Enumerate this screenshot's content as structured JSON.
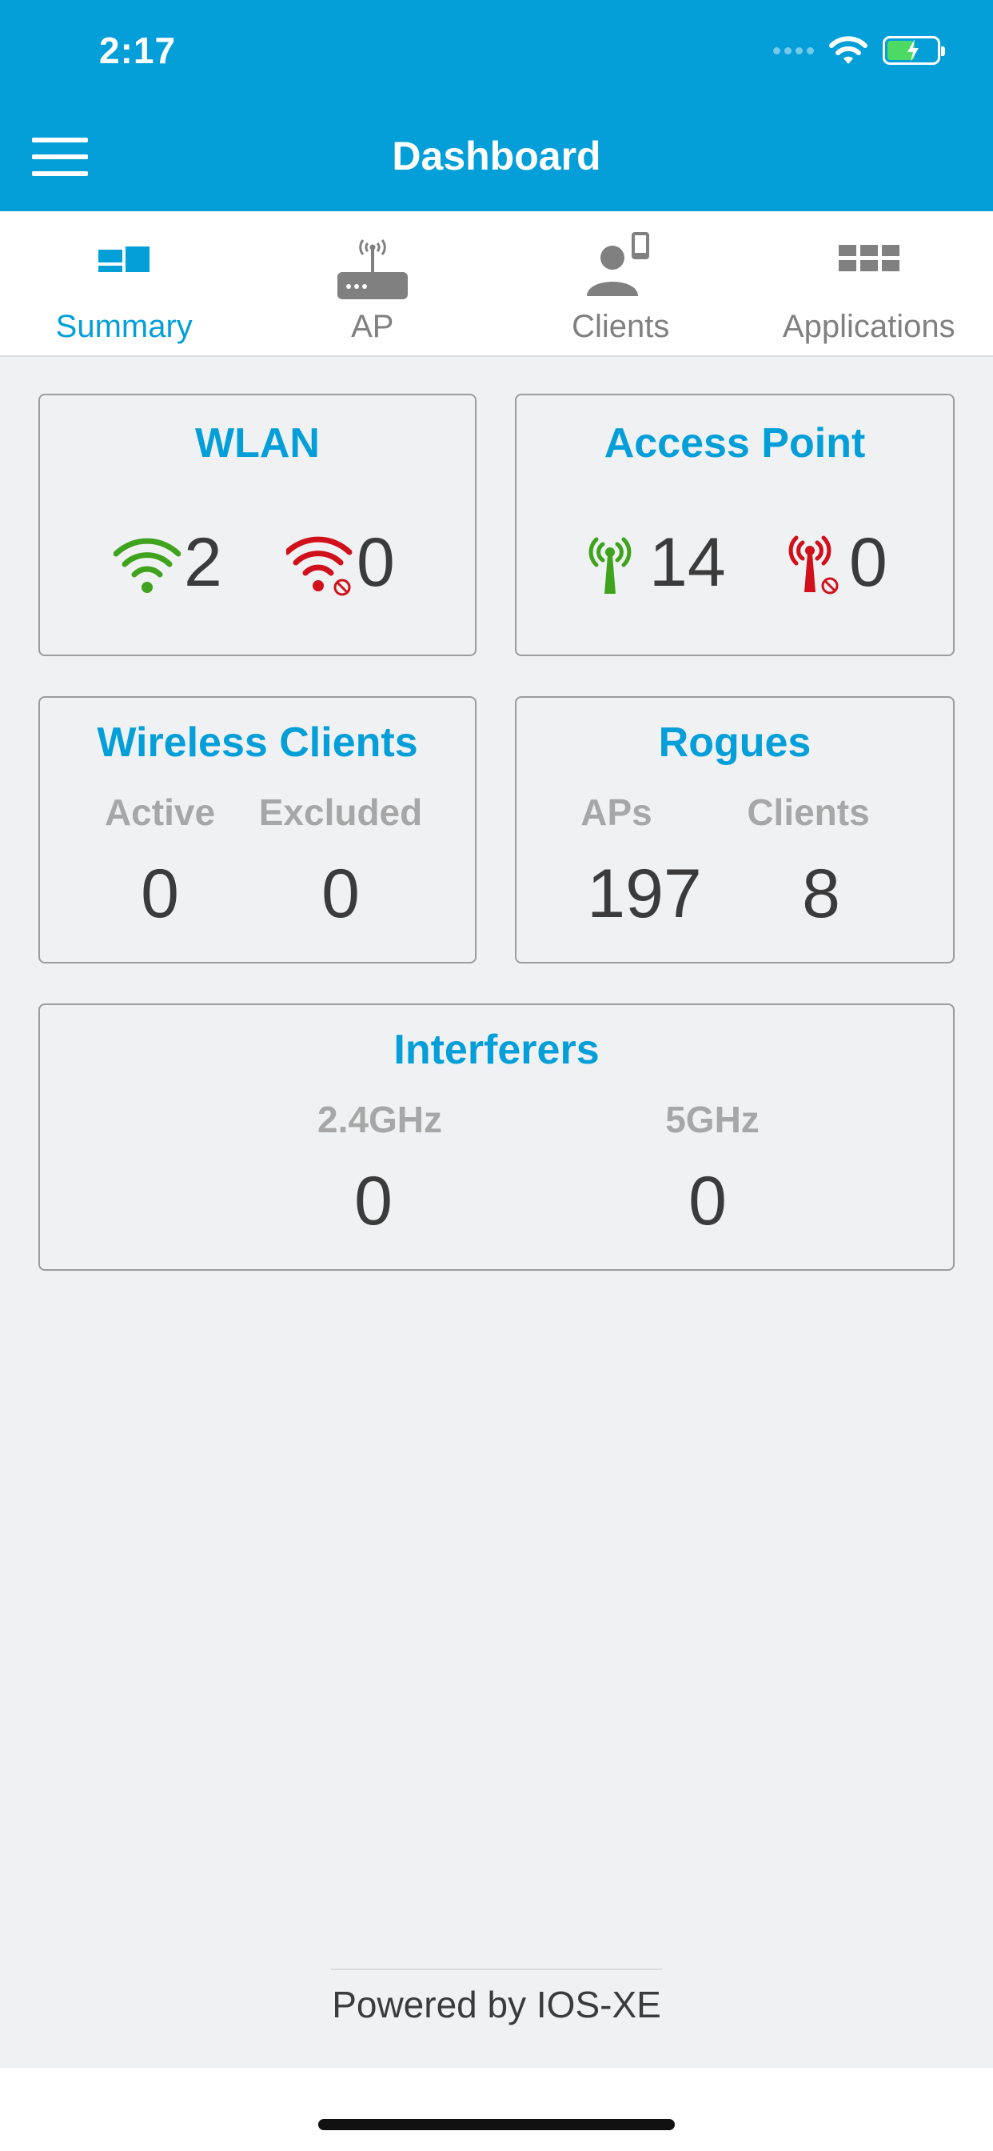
{
  "status_bar": {
    "time": "2:17"
  },
  "header": {
    "title": "Dashboard"
  },
  "tabs": [
    {
      "label": "Summary",
      "icon": "summary-icon",
      "active": true
    },
    {
      "label": "AP",
      "icon": "access-point-icon",
      "active": false
    },
    {
      "label": "Clients",
      "icon": "client-icon",
      "active": false
    },
    {
      "label": "Applications",
      "icon": "grid-icon",
      "active": false
    }
  ],
  "cards": {
    "wlan": {
      "title": "WLAN",
      "up": "2",
      "down": "0"
    },
    "access_point": {
      "title": "Access Point",
      "up": "14",
      "down": "0"
    },
    "wireless_clients": {
      "title": "Wireless Clients",
      "columns": [
        {
          "label": "Active",
          "value": "0"
        },
        {
          "label": "Excluded",
          "value": "0"
        }
      ]
    },
    "rogues": {
      "title": "Rogues",
      "columns": [
        {
          "label": "APs",
          "value": "197"
        },
        {
          "label": "Clients",
          "value": "8"
        }
      ]
    },
    "interferers": {
      "title": "Interferers",
      "columns": [
        {
          "label": "2.4GHz",
          "value": "0"
        },
        {
          "label": "5GHz",
          "value": "0"
        }
      ]
    }
  },
  "footer": {
    "text": "Powered by IOS-XE"
  },
  "colors": {
    "brand": "#049fd9",
    "ok": "#3fa31d",
    "alert": "#d0101a",
    "muted": "#a7a7a7"
  }
}
